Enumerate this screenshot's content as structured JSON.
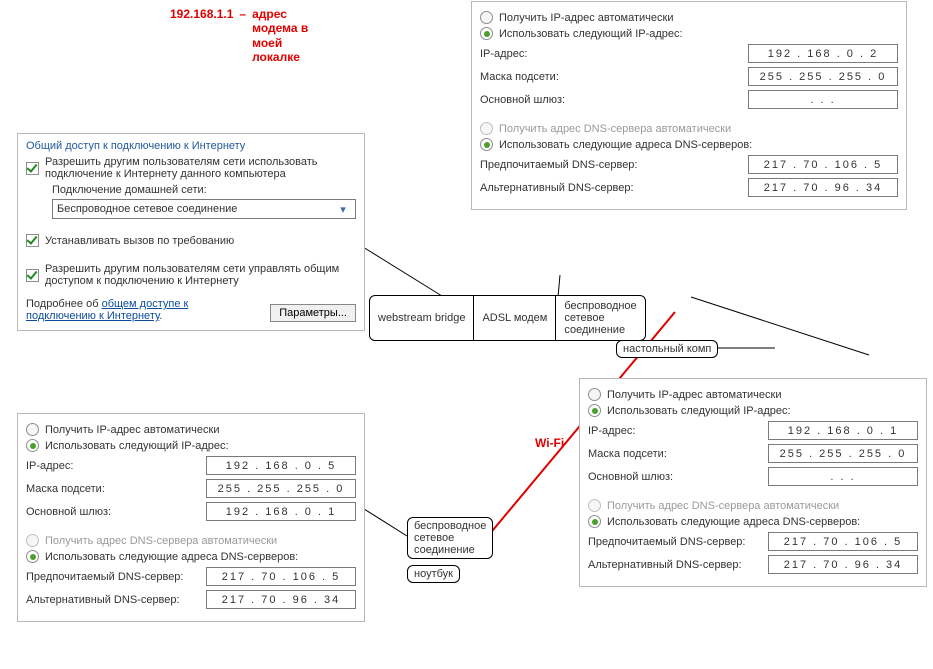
{
  "annotation": {
    "ip": "192.168.1.1",
    "dash": "–",
    "note": "адрес модема в моей локалке"
  },
  "wifi_label": "Wi-Fi",
  "ics": {
    "title": "Общий доступ к подключению к Интернету",
    "allow_label": "Разрешить другим пользователям сети использовать подключение к Интернету данного компьютера",
    "home_label": "Подключение домашней сети:",
    "home_value": "Беспроводное сетевое соединение",
    "dial_label": "Устанавливать вызов по требованию",
    "manage_label": "Разрешить другим пользователям сети управлять общим доступом к подключению к Интернету",
    "more_prefix": "Подробнее об ",
    "more_link": "общем доступе к подключению к Интернету",
    "params_btn": "Параметры..."
  },
  "segbox": {
    "a": "webstream bridge",
    "b": "ADSL модем",
    "c": "беспроводное\nсетевое\nсоединение"
  },
  "desktop_label": "настольный комп",
  "laptop_seg": "беспроводное\nсетевое\nсоединение",
  "laptop_label": "ноутбук",
  "tcp_labels": {
    "auto_ip": "Получить IP-адрес автоматически",
    "use_ip": "Использовать следующий IP-адрес:",
    "ip": "IP-адрес:",
    "mask": "Маска подсети:",
    "gw": "Основной шлюз:",
    "auto_dns": "Получить адрес DNS-сервера автоматически",
    "use_dns": "Использовать следующие адреса DNS-серверов:",
    "dns1": "Предпочитаемый DNS-сервер:",
    "dns2": "Альтернативный DNS-сервер:"
  },
  "panel_top": {
    "ip": "192 . 168 .   0  .   2",
    "mask": "255 . 255 . 255 .   0",
    "gw": ".         .         .",
    "dns1": "217 .  70  . 106 .   5",
    "dns2": "217 .  70  .  96  .  34"
  },
  "panel_right": {
    "ip": "192 . 168 .   0  .   1",
    "mask": "255 . 255 . 255 .   0",
    "gw": ".         .         .",
    "dns1": "217 .  70  . 106 .   5",
    "dns2": "217 .  70  .  96  .  34"
  },
  "panel_left": {
    "ip": "192 . 168 .   0  .   5",
    "mask": "255 . 255 . 255 .   0",
    "gw": "192 . 168 .   0  .   1",
    "dns1": "217 .  70  . 106 .   5",
    "dns2": "217 .  70  .  96  .  34"
  }
}
